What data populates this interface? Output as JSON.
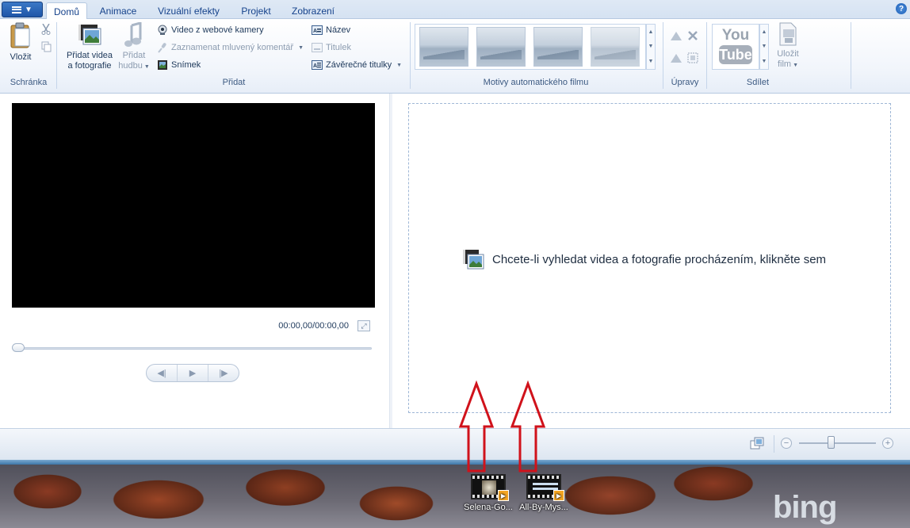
{
  "tabs": {
    "home": "Domů",
    "animations": "Animace",
    "visual_effects": "Vizuální efekty",
    "project": "Projekt",
    "view": "Zobrazení"
  },
  "help_icon": "?",
  "ribbon": {
    "clipboard": {
      "paste": "Vložit",
      "group": "Schránka"
    },
    "add": {
      "add_videos_line1": "Přidat videa",
      "add_videos_line2": "a fotografie",
      "add_music_line1": "Přidat",
      "add_music_line2": "hudbu",
      "webcam": "Video z webové kamery",
      "narration": "Zaznamenat mluvený komentář",
      "snapshot": "Snímek",
      "title": "Název",
      "caption": "Titulek",
      "credits": "Závěrečné titulky",
      "group": "Přidat"
    },
    "themes": {
      "group": "Motivy automatického filmu"
    },
    "editing": {
      "group": "Úpravy"
    },
    "share": {
      "youtube_line1": "You",
      "youtube_line2": "Tube",
      "save_movie_line1": "Uložit",
      "save_movie_line2": "film",
      "group": "Sdílet"
    }
  },
  "player": {
    "timecode": "00:00,00/00:00,00",
    "prev_frame": "◀|",
    "play": "▶",
    "next_frame": "|▶"
  },
  "storyboard": {
    "browse_text": "Chcete-li vyhledat videa a fotografie procházením, klikněte sem"
  },
  "statusbar": {
    "zoom_minus": "−",
    "zoom_plus": "+"
  },
  "desktop": {
    "icon1": "Selena-Go...",
    "icon2": "All-By-Mys...",
    "wallpaper_brand": "bing"
  },
  "colors": {
    "ribbon_text": "#1e395b",
    "accent_blue": "#15428b",
    "annotation_red": "#d0121b"
  }
}
